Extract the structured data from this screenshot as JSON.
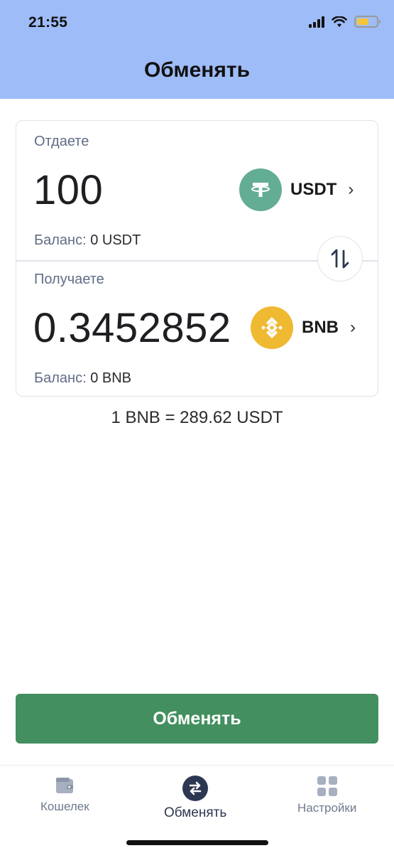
{
  "status_bar": {
    "time": "21:55"
  },
  "header": {
    "title": "Обменять"
  },
  "give": {
    "label": "Отдаете",
    "amount": "100",
    "coin": "USDT",
    "coin_icon": "tether-icon",
    "coin_color": "#64ad95",
    "balance_label": "Баланс:",
    "balance_value": "0 USDT"
  },
  "receive": {
    "label": "Получаете",
    "amount": "0.3452852",
    "coin": "BNB",
    "coin_icon": "binance-coin-icon",
    "coin_color": "#efb932",
    "balance_label": "Баланс:",
    "balance_value": "0 BNB"
  },
  "rate": "1 BNB = 289.62 USDT",
  "action": {
    "label": "Обменять",
    "color": "#438f5f"
  },
  "tabs": [
    {
      "label": "Кошелек",
      "icon": "wallet-icon",
      "active": false
    },
    {
      "label": "Обменять",
      "icon": "exchange-icon",
      "active": true
    },
    {
      "label": "Настройки",
      "icon": "settings-grid-icon",
      "active": false
    }
  ],
  "colors": {
    "header": "#9ebcf8",
    "muted_text": "#5f6d86"
  }
}
